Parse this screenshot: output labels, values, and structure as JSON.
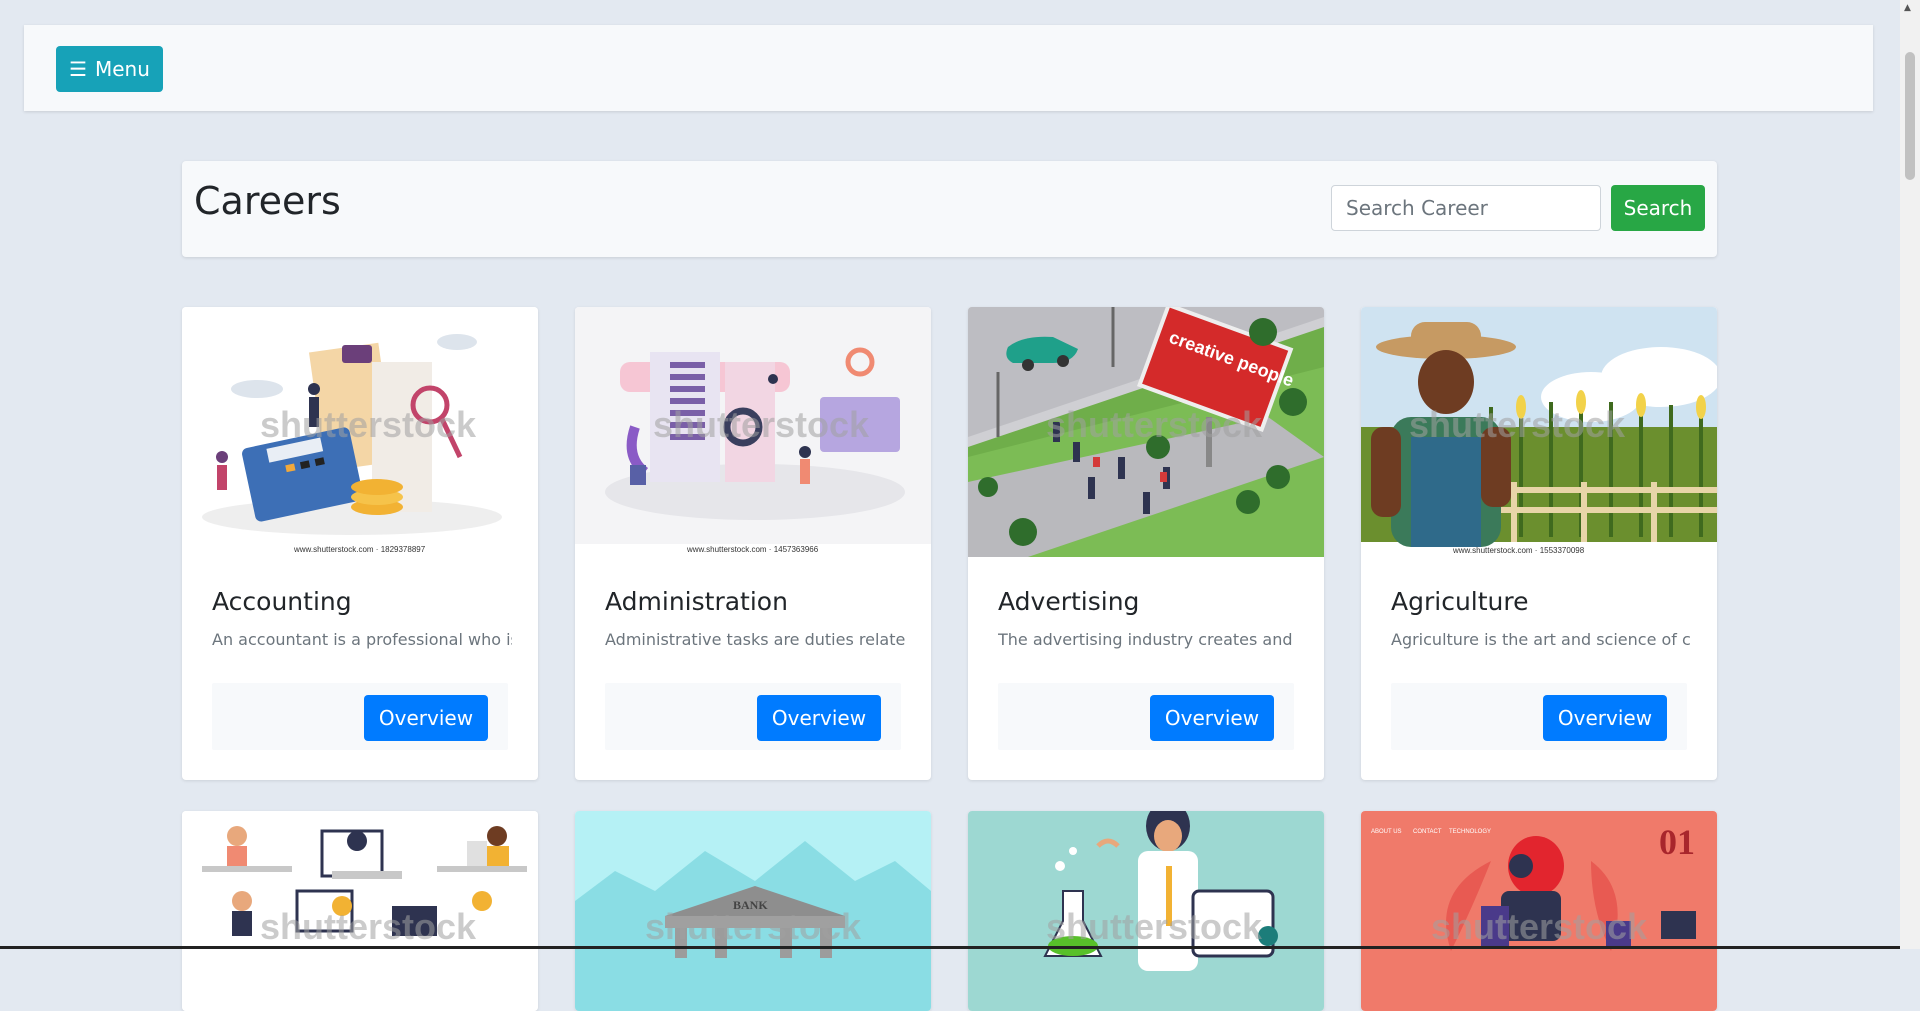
{
  "nav": {
    "menu_label": "Menu",
    "menu_icon": "☰"
  },
  "header": {
    "title": "Careers",
    "search_placeholder": "Search Career",
    "search_button": "Search"
  },
  "cards": [
    {
      "title": "Accounting",
      "desc": "An accountant is a professional who is r...",
      "button": "Overview",
      "watermark": "shutterstock",
      "image_id": "www.shutterstock.com · 1829378897"
    },
    {
      "title": "Administration",
      "desc": "Administrative tasks are duties related t...",
      "button": "Overview",
      "watermark": "shutterstock",
      "image_id": "www.shutterstock.com · 1457363966"
    },
    {
      "title": "Advertising",
      "desc": "The advertising industry creates and m...",
      "button": "Overview",
      "watermark": "shutterstock",
      "billboard_text": "creative people"
    },
    {
      "title": "Agriculture",
      "desc": "Agriculture is the art and science of cult...",
      "button": "Overview",
      "watermark": "shutterstock",
      "image_id": "www.shutterstock.com · 1553370098"
    }
  ],
  "cards_row2": [
    {
      "watermark": "shutterstock"
    },
    {
      "watermark": "shutterstock",
      "bank_label": "BANK"
    },
    {
      "watermark": "shutterstock"
    },
    {
      "watermark": "shutterstock",
      "number": "01",
      "nav_about": "ABOUT US",
      "nav_contact": "CONTACT",
      "nav_tech": "TECHNOLOGY"
    }
  ],
  "colors": {
    "menu": "#17a2b8",
    "search": "#28a745",
    "overview": "#007bff",
    "background": "#e3e9f1"
  }
}
